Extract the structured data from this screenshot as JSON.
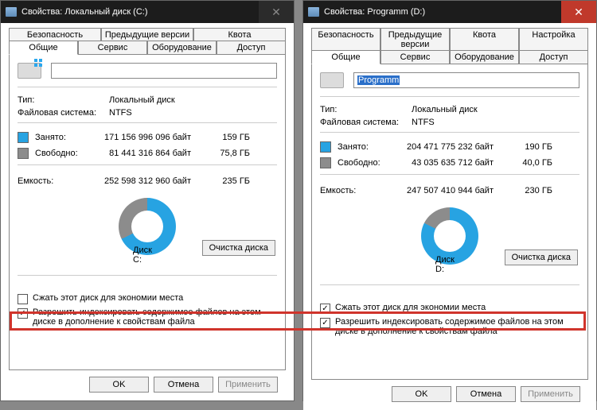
{
  "left": {
    "title": "Свойства: Локальный диск (C:)",
    "tabs_row1": [
      "Безопасность",
      "Предыдущие версии",
      "Квота"
    ],
    "tabs_row2": [
      "Общие",
      "Сервис",
      "Оборудование",
      "Доступ"
    ],
    "active_tab": "Общие",
    "drive_name": "",
    "type_label": "Тип:",
    "type_value": "Локальный диск",
    "fs_label": "Файловая система:",
    "fs_value": "NTFS",
    "used_label": "Занято:",
    "used_bytes": "171 156 996 096 байт",
    "used_gb": "159 ГБ",
    "free_label": "Свободно:",
    "free_bytes": "81 441 316 864 байт",
    "free_gb": "75,8 ГБ",
    "cap_label": "Емкость:",
    "cap_bytes": "252 598 312 960 байт",
    "cap_gb": "235 ГБ",
    "disk_caption": "Диск C:",
    "cleanup": "Очистка диска",
    "chk1": "Сжать этот диск для экономии места",
    "chk1_checked": false,
    "chk2": "Разрешить индексировать содержимое файлов на этом диске в дополнение к свойствам файла",
    "chk2_checked": true,
    "ok": "OK",
    "cancel": "Отмена",
    "apply": "Применить",
    "donut_used_deg": 244
  },
  "right": {
    "title": "Свойства: Programm (D:)",
    "tabs_row1": [
      "Безопасность",
      "Предыдущие версии",
      "Квота",
      "Настройка"
    ],
    "tabs_row2": [
      "Общие",
      "Сервис",
      "Оборудование",
      "Доступ"
    ],
    "active_tab": "Общие",
    "drive_name": "Programm",
    "type_label": "Тип:",
    "type_value": "Локальный диск",
    "fs_label": "Файловая система:",
    "fs_value": "NTFS",
    "used_label": "Занято:",
    "used_bytes": "204 471 775 232 байт",
    "used_gb": "190 ГБ",
    "free_label": "Свободно:",
    "free_bytes": "43 035 635 712 байт",
    "free_gb": "40,0 ГБ",
    "cap_label": "Емкость:",
    "cap_bytes": "247 507 410 944 байт",
    "cap_gb": "230 ГБ",
    "disk_caption": "Диск D:",
    "cleanup": "Очистка диска",
    "chk1": "Сжать этот диск для экономии места",
    "chk1_checked": true,
    "chk2": "Разрешить индексировать содержимое файлов на этом диске в дополнение к свойствам файла",
    "chk2_checked": true,
    "ok": "OK",
    "cancel": "Отмена",
    "apply": "Применить",
    "donut_used_deg": 297
  },
  "chart_data": [
    {
      "type": "pie",
      "title": "Диск C:",
      "series": [
        {
          "name": "Занято",
          "value": 171156996096,
          "label": "159 ГБ",
          "color": "#27a3e2"
        },
        {
          "name": "Свободно",
          "value": 81441316864,
          "label": "75,8 ГБ",
          "color": "#8c8c8c"
        }
      ],
      "total": {
        "name": "Емкость",
        "value": 252598312960,
        "label": "235 ГБ"
      }
    },
    {
      "type": "pie",
      "title": "Диск D:",
      "series": [
        {
          "name": "Занято",
          "value": 204471775232,
          "label": "190 ГБ",
          "color": "#27a3e2"
        },
        {
          "name": "Свободно",
          "value": 43035635712,
          "label": "40,0 ГБ",
          "color": "#8c8c8c"
        }
      ],
      "total": {
        "name": "Емкость",
        "value": 247507410944,
        "label": "230 ГБ"
      }
    }
  ]
}
